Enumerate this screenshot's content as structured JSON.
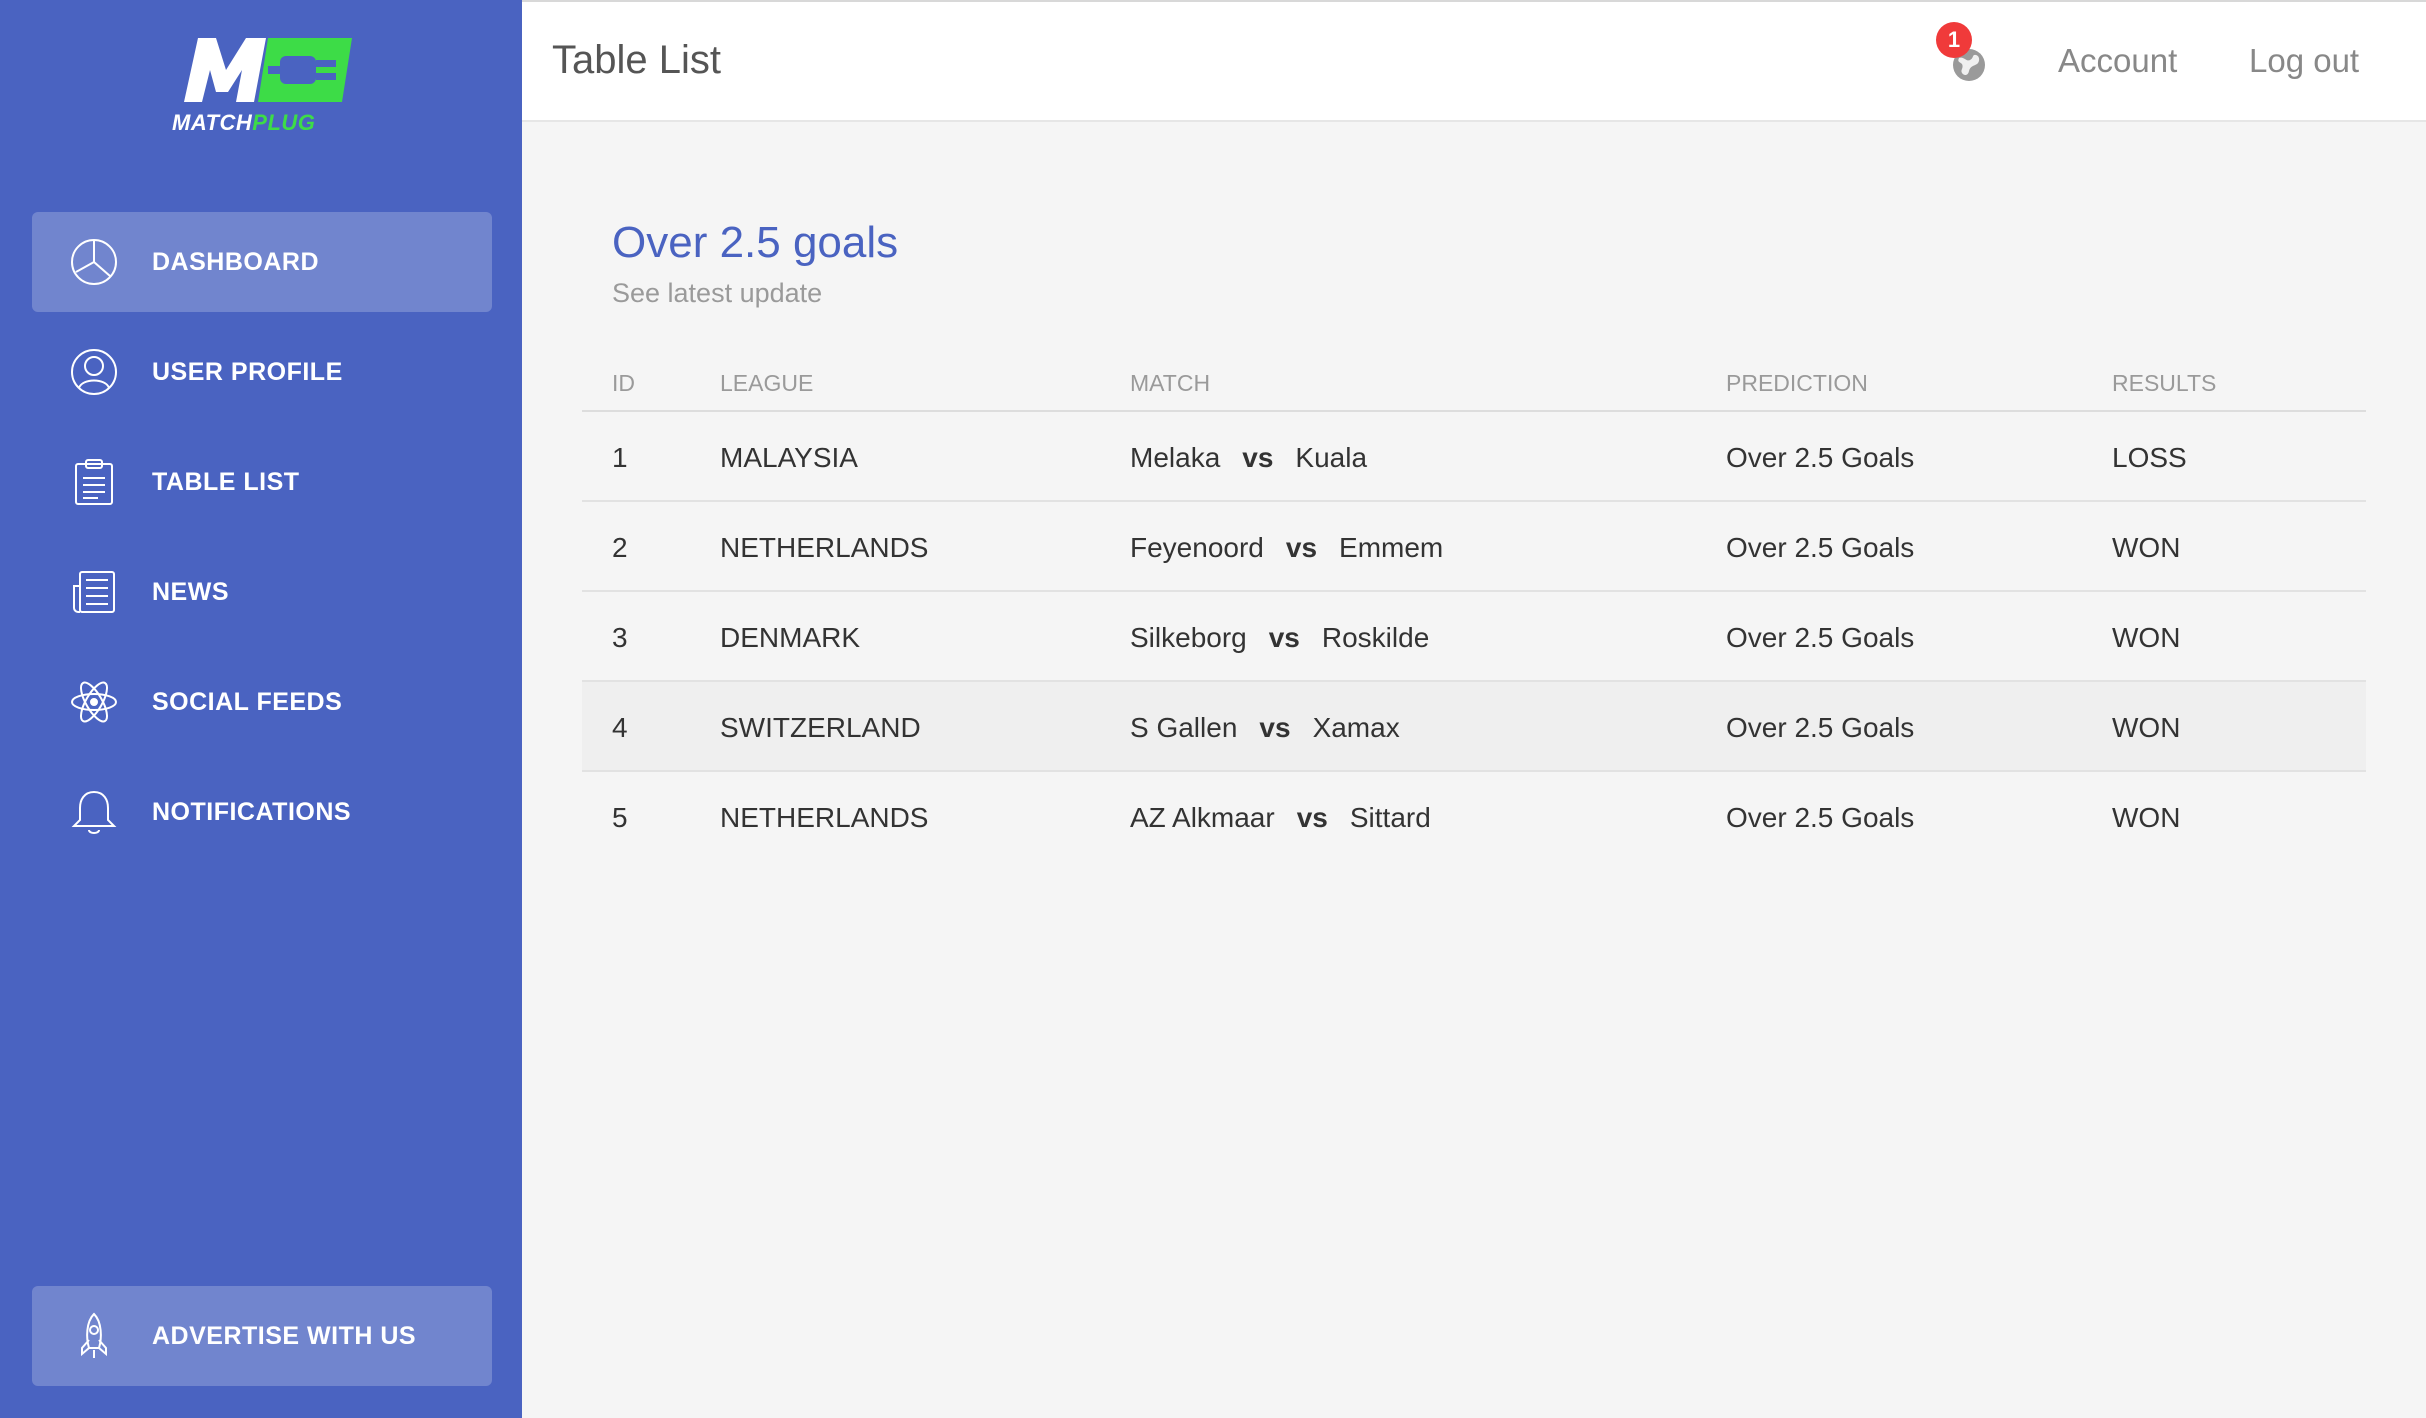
{
  "brand": {
    "logo_text_white": "MATCH",
    "logo_text_green": "PLUG",
    "color_primary": "#4a63c1",
    "color_green": "#3ddc47"
  },
  "sidebar": {
    "items": [
      {
        "label": "DASHBOARD",
        "icon": "pie-chart-icon",
        "active": true
      },
      {
        "label": "USER PROFILE",
        "icon": "user-icon",
        "active": false
      },
      {
        "label": "TABLE LIST",
        "icon": "clipboard-icon",
        "active": false
      },
      {
        "label": "NEWS",
        "icon": "newspaper-icon",
        "active": false
      },
      {
        "label": "SOCIAL FEEDS",
        "icon": "atom-icon",
        "active": false
      },
      {
        "label": "NOTIFICATIONS",
        "icon": "bell-icon",
        "active": false
      }
    ],
    "footer_item": {
      "label": "ADVERTISE WITH US",
      "icon": "rocket-icon"
    }
  },
  "header": {
    "title": "Table List",
    "notification_count": "1",
    "account_label": "Account",
    "logout_label": "Log out"
  },
  "card": {
    "title": "Over 2.5 goals",
    "subtitle": "See latest update"
  },
  "table": {
    "columns": [
      "ID",
      "LEAGUE",
      "MATCH",
      "PREDICTION",
      "RESULTS"
    ],
    "vs_label": "vs",
    "rows": [
      {
        "id": "1",
        "league": "MALAYSIA",
        "home": "Melaka",
        "away": "Kuala",
        "prediction": "Over 2.5 Goals",
        "result": "LOSS"
      },
      {
        "id": "2",
        "league": "NETHERLANDS",
        "home": "Feyenoord",
        "away": "Emmem",
        "prediction": "Over 2.5 Goals",
        "result": "WON"
      },
      {
        "id": "3",
        "league": "DENMARK",
        "home": "Silkeborg",
        "away": "Roskilde",
        "prediction": "Over 2.5 Goals",
        "result": "WON"
      },
      {
        "id": "4",
        "league": "SWITZERLAND",
        "home": "S Gallen",
        "away": "Xamax",
        "prediction": "Over 2.5 Goals",
        "result": "WON"
      },
      {
        "id": "5",
        "league": "NETHERLANDS",
        "home": "AZ Alkmaar",
        "away": "Sittard",
        "prediction": "Over 2.5 Goals",
        "result": "WON"
      }
    ]
  }
}
